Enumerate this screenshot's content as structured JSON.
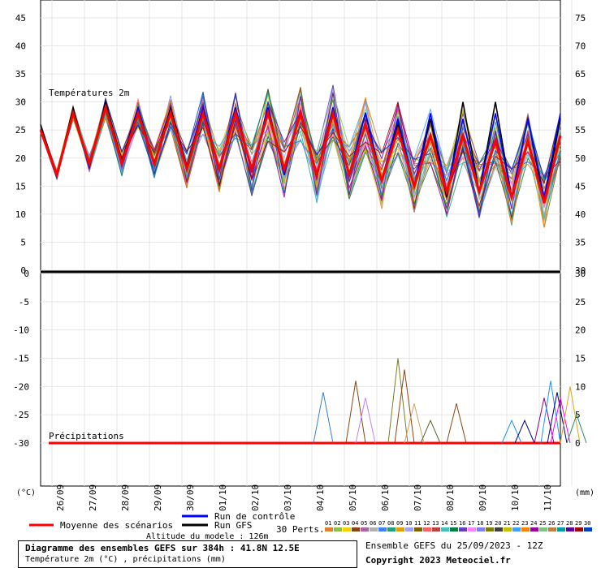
{
  "chart_data": [
    {
      "type": "line",
      "title": "Températures 2m",
      "y_left_ticks": [
        0,
        5,
        10,
        15,
        20,
        25,
        30,
        35,
        40,
        45
      ],
      "y_right_ticks": [
        30,
        35,
        40,
        45,
        50,
        55,
        60,
        65,
        70,
        75
      ],
      "ylim": [
        0,
        48
      ],
      "dates": [
        "26/09",
        "27/09",
        "28/09",
        "29/09",
        "30/09",
        "01/10",
        "02/10",
        "03/10",
        "04/10",
        "05/10",
        "06/10",
        "07/10",
        "08/10",
        "09/10",
        "10/10",
        "11/10"
      ],
      "x_days_from_start": [
        0,
        0.5,
        1,
        1.5,
        2,
        2.5,
        3,
        3.5,
        4,
        4.5,
        5,
        5.5,
        6,
        6.5,
        7,
        7.5,
        8,
        8.5,
        9,
        9.5,
        10,
        10.5,
        11,
        11.5,
        12,
        12.5,
        13,
        13.5,
        14,
        14.5,
        15,
        15.5,
        16
      ],
      "series": [
        {
          "name": "Moyenne des scénarios",
          "color": "#ff0000",
          "values": [
            25,
            17,
            28,
            19,
            29,
            19,
            28,
            19,
            28,
            18,
            28,
            18,
            28,
            18,
            28,
            18,
            28,
            17,
            28,
            17,
            26,
            16,
            25,
            15,
            24,
            14,
            24,
            14,
            23,
            13,
            23,
            12,
            24
          ]
        },
        {
          "name": "Run de contrôle",
          "color": "#0000ff",
          "values": [
            25,
            16.5,
            28,
            18.5,
            29,
            19,
            29,
            19,
            28.5,
            18,
            29,
            18,
            29,
            17.5,
            29,
            17,
            28.5,
            16.5,
            29,
            17,
            28,
            16,
            27,
            15,
            28,
            14,
            27,
            14,
            28,
            13,
            27,
            13,
            28
          ]
        },
        {
          "name": "Run GFS",
          "color": "#000000",
          "values": [
            26,
            17,
            29,
            18.5,
            30,
            19.5,
            29,
            19,
            29,
            18.5,
            29,
            18,
            29,
            17.5,
            29,
            17,
            28.5,
            17,
            29,
            17,
            28,
            16,
            26,
            15,
            27,
            13,
            30,
            14,
            30,
            13,
            27,
            12,
            27
          ]
        }
      ]
    },
    {
      "type": "line",
      "title": "Précipitations",
      "y_left_ticks": [
        0,
        -5,
        -10,
        -15,
        -20,
        -25,
        -30
      ],
      "y_right_ticks": [
        30,
        25,
        20,
        15,
        10,
        5,
        0
      ],
      "unit_left": "(°C)",
      "unit_right": "(mm)",
      "peaks": [
        {
          "day": 8.7,
          "mm": 9,
          "color": "#3a7bd5"
        },
        {
          "day": 9.7,
          "mm": 11,
          "color": "#8b4513"
        },
        {
          "day": 10.0,
          "mm": 8,
          "color": "#c080ff"
        },
        {
          "day": 11.0,
          "mm": 15,
          "color": "#7a7a20"
        },
        {
          "day": 11.2,
          "mm": 13,
          "color": "#8b4513"
        },
        {
          "day": 11.5,
          "mm": 7,
          "color": "#d2a060"
        },
        {
          "day": 12.0,
          "mm": 4,
          "color": "#556b2f"
        },
        {
          "day": 12.8,
          "mm": 7,
          "color": "#8b4513"
        },
        {
          "day": 14.5,
          "mm": 4,
          "color": "#1e90ff"
        },
        {
          "day": 14.9,
          "mm": 4,
          "color": "#000080"
        },
        {
          "day": 15.5,
          "mm": 8,
          "color": "#8b008b"
        },
        {
          "day": 15.7,
          "mm": 11,
          "color": "#1e90ff"
        },
        {
          "day": 15.9,
          "mm": 9,
          "color": "#000080"
        },
        {
          "day": 16.0,
          "mm": 8,
          "color": "#ff00ff"
        },
        {
          "day": 16.3,
          "mm": 10,
          "color": "#daa520"
        },
        {
          "day": 16.5,
          "mm": 5,
          "color": "#2e8b57"
        }
      ]
    }
  ],
  "legend": {
    "mean_label": "Moyenne des scénarios",
    "control_label": "Run de contrôle",
    "gfs_label": "Run GFS",
    "perts_label": "30 Perts.",
    "altitude_label": "Altitude du modele : 126m",
    "pert_numbers": [
      "01",
      "02",
      "03",
      "04",
      "05",
      "06",
      "07",
      "08",
      "09",
      "10",
      "11",
      "12",
      "13",
      "14",
      "15",
      "16",
      "17",
      "18",
      "19",
      "20",
      "21",
      "22",
      "23",
      "24",
      "25",
      "26",
      "27",
      "28",
      "29",
      "30"
    ],
    "pert_colors": [
      "#e08030",
      "#90c040",
      "#ffd000",
      "#8b4513",
      "#b060b0",
      "#b0b0b0",
      "#4080ff",
      "#20a080",
      "#e0a000",
      "#a0a0ff",
      "#806000",
      "#ff6060",
      "#c04040",
      "#40c0c0",
      "#008040",
      "#6040c0",
      "#ff80ff",
      "#8080ff",
      "#808000",
      "#404040",
      "#c0c000",
      "#40a0ff",
      "#ff8000",
      "#a000a0",
      "#80c080",
      "#c08040",
      "#00a0a0",
      "#6000a0",
      "#a00000",
      "#0040c0"
    ]
  },
  "footer": {
    "line1": "Diagramme des ensembles GEFS sur 384h : 41.8N 12.5E",
    "line2": "Température 2m (°C) , précipitations (mm)",
    "ensemble": "Ensemble GEFS du 25/09/2023 - 12Z",
    "copyright": "Copyright 2023 Meteociel.fr"
  }
}
